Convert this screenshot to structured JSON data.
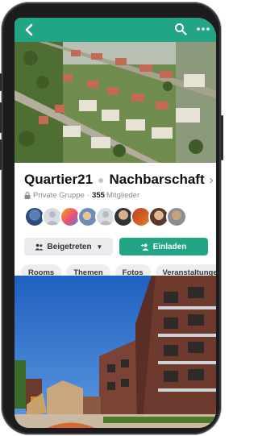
{
  "header": {
    "back_icon": "back-chevron-icon",
    "search_icon": "search-icon",
    "more_icon": "more-dots-icon",
    "color": "#22a584"
  },
  "group": {
    "name": "Quartier21",
    "subtitle": "Nachbarschaft",
    "privacy": "Private Gruppe",
    "member_count": "355",
    "member_label": "Mitglieder"
  },
  "actions": {
    "joined_label": "Beigetreten",
    "invite_label": "Einladen"
  },
  "tabs": [
    {
      "label": "Rooms"
    },
    {
      "label": "Themen"
    },
    {
      "label": "Fotos"
    },
    {
      "label": "Veranstaltungen"
    }
  ],
  "avatars_count": 9
}
